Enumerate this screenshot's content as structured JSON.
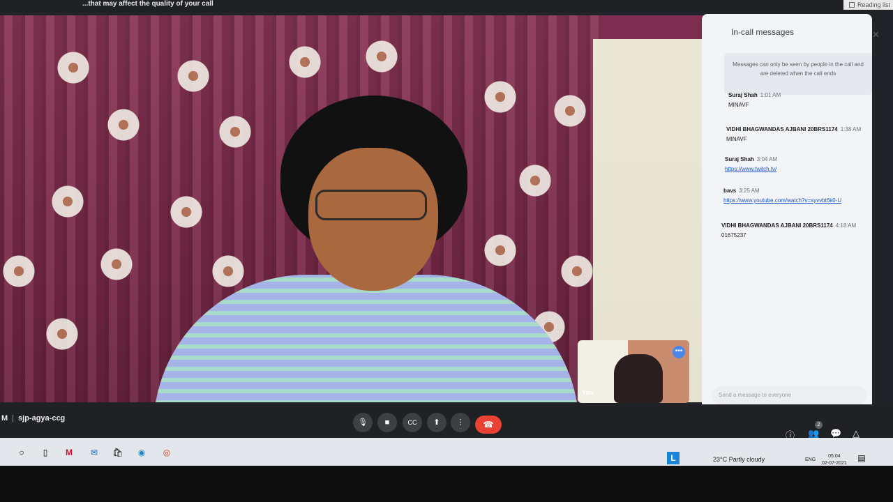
{
  "browser": {
    "warning_text": "...that may affect the quality of your call",
    "reading_list_label": "Reading list"
  },
  "call": {
    "meeting_code": "sjp-agya-ccg",
    "time_fragment": "M",
    "self_label": "You"
  },
  "chat": {
    "title": "In-call messages",
    "notice": "Messages can only be seen by people in the call and are deleted when the call ends",
    "messages": [
      {
        "sender": "Suraj Shah",
        "time": "1:01 AM",
        "text": "MINAVF"
      },
      {
        "sender": "VIDHI BHAGWANDAS AJBANI 20BRS1174",
        "time": "1:38 AM",
        "text": "MINAVF"
      },
      {
        "sender": "Suraj Shah",
        "time": "3:04 AM",
        "text": "https://www.twitch.tv/"
      },
      {
        "sender": "bavs",
        "time": "3:25 AM",
        "text": "https://www.youtube.com/watch?v=syvvbt6k0-U"
      },
      {
        "sender": "VIDHI BHAGWANDAS AJBANI 20BRS1174",
        "time": "4:18 AM",
        "text": "01675237"
      }
    ],
    "input_placeholder": "Send a message to everyone"
  },
  "controls": {
    "people_count": "2"
  },
  "taskbar": {
    "weather": "23°C  Partly cloudy",
    "language": "ENG",
    "clock_time": "05:04",
    "clock_date": "02-07-2021",
    "teams_letter": "L"
  },
  "colors": {
    "end_call": "#ea4335",
    "link": "#1a56c7",
    "chat_panel_bg": "#f3f4f8",
    "control_bar_bg": "#202124"
  }
}
